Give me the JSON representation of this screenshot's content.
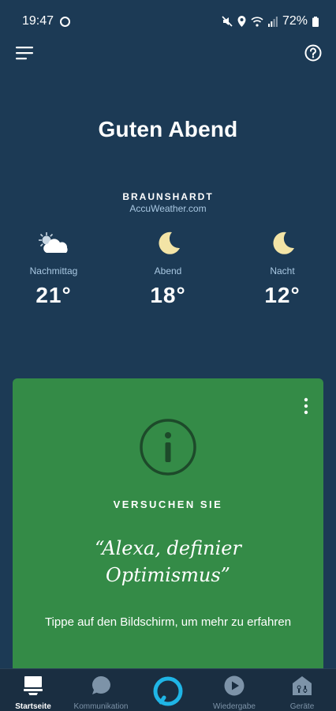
{
  "status": {
    "time": "19:47",
    "battery": "72%"
  },
  "greeting": "Guten Abend",
  "weather": {
    "location": "BRAUNSHARDT",
    "provider": "AccuWeather.com",
    "periods": [
      {
        "label": "Nachmittag",
        "temp": "21°",
        "icon": "partly-cloudy-icon"
      },
      {
        "label": "Abend",
        "temp": "18°",
        "icon": "moon-icon"
      },
      {
        "label": "Nacht",
        "temp": "12°",
        "icon": "moon-icon"
      }
    ]
  },
  "card": {
    "kicker": "VERSUCHEN SIE",
    "quote_line1": "“Alexa, definier",
    "quote_line2": "Optimismus”",
    "hint": "Tippe auf den Bildschirm, um mehr zu erfahren",
    "background": "#348b47"
  },
  "nav": {
    "items": [
      {
        "label": "Startseite",
        "icon": "home-icon"
      },
      {
        "label": "Kommunikation",
        "icon": "chat-icon"
      },
      {
        "label": "Wiedergabe",
        "icon": "play-icon"
      },
      {
        "label": "Geräte",
        "icon": "devices-icon"
      }
    ],
    "active": "Startseite"
  },
  "colors": {
    "background": "#1c3a55",
    "accent": "#1fb5e6",
    "muted_text": "#a9c8e2"
  }
}
